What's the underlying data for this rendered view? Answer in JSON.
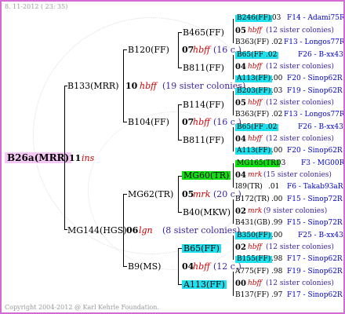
{
  "header": {
    "date": "8. 11-2012 ( 23: 35)"
  },
  "footer": {
    "copyright": "Copyright 2004-2012 @ Karl Kehrle Foundation."
  },
  "root": {
    "name": "B26a(MRR)",
    "num": "11",
    "tag": "ins"
  },
  "gen1": [
    {
      "name": "B133(MRR)",
      "num": "10",
      "tag": "hbff",
      "note": "(19 sister colonies)"
    },
    {
      "name": "MG144(HGS)",
      "num": "06",
      "tag": "lgn",
      "note": "(8 sister colonies)"
    }
  ],
  "gen2": [
    {
      "name": "B120(FF)"
    },
    {
      "name": "B104(FF)"
    },
    {
      "name": "MG62(TR)"
    },
    {
      "name": "B9(MS)"
    }
  ],
  "gen3": [
    {
      "name": "B465(FF)",
      "num": "07",
      "tag": "hbff",
      "note": "(16 c.)"
    },
    {
      "name": "B811(FF)"
    },
    {
      "name": "B114(FF)",
      "num": "07",
      "tag": "hbff",
      "note": "(16 c.)"
    },
    {
      "name": "B811(FF)"
    },
    {
      "name": "MG60(TR)",
      "num": "05",
      "tag": "mrk",
      "note": "(20 c.)"
    },
    {
      "name": "B40(MKW)"
    },
    {
      "name": "B65(FF)",
      "num": "04",
      "tag": "hbff",
      "note": "(12 c.)"
    },
    {
      "name": "A113(FF)"
    }
  ],
  "gen4": [
    {
      "name": "B246(FF)",
      "val": ".03",
      "code": "F14 - Adami75R",
      "num": "05",
      "tag": "hbff",
      "note": "(12 sister colonies)"
    },
    {
      "name": "B363(FF)",
      "val": ".02",
      "code": "F13 - Longos77R"
    },
    {
      "name": "B65(FF)",
      "val": ".02",
      "code": "F26 - B-xx43",
      "num": "04",
      "tag": "hbff",
      "note": "(12 sister colonies)"
    },
    {
      "name": "A113(FF)",
      "val": ".00",
      "code": "F20 - Sinop62R"
    },
    {
      "name": "B203(FF)",
      "val": ".03",
      "code": "F19 - Sinop62R",
      "num": "05",
      "tag": "hbff",
      "note": "(12 sister colonies)"
    },
    {
      "name": "B363(FF)",
      "val": ".02",
      "code": "F13 - Longos77R"
    },
    {
      "name": "B65(FF)",
      "val": ".02",
      "code": "F26 - B-xx43",
      "num": "04",
      "tag": "hbff",
      "note": "(12 sister colonies)"
    },
    {
      "name": "A113(FF)",
      "val": ".00",
      "code": "F20 - Sinop62R"
    },
    {
      "name": "MG165(TR)",
      "val": ".03",
      "code": "F3 - MG00R",
      "num": "04",
      "tag": "mrk",
      "note": "(15 sister colonies)"
    },
    {
      "name": "I89(TR)",
      "val": ".01",
      "code": "F6 - Takab93aR"
    },
    {
      "name": "B172(TR)",
      "val": ".00",
      "code": "F15 - Sinop72R",
      "num": "02",
      "tag": "mrk",
      "note": "(9 sister colonies)"
    },
    {
      "name": "B431(GB)",
      "val": ".99",
      "code": "F15 - Sinop72R"
    },
    {
      "name": "B350(FF)",
      "val": ".00",
      "code": "F25 - B-xx43",
      "num": "02",
      "tag": "hbff",
      "note": "(12 sister colonies)"
    },
    {
      "name": "B155(FF)",
      "val": ".98",
      "code": "F17 - Sinop62R"
    },
    {
      "name": "A775(FF)",
      "val": ".98",
      "code": "F19 - Sinop62R",
      "num": "00",
      "tag": "hbff",
      "note": "(12 sister colonies)"
    },
    {
      "name": "B137(FF)",
      "val": ".97",
      "code": "F17 - Sinop62R"
    }
  ],
  "colors": {
    "frame": "#d46ad4",
    "cyan": "#20e0ee",
    "green": "#10e010",
    "pink": "#f4c8f4",
    "red": "#d00000",
    "blue": "#0000cc"
  }
}
